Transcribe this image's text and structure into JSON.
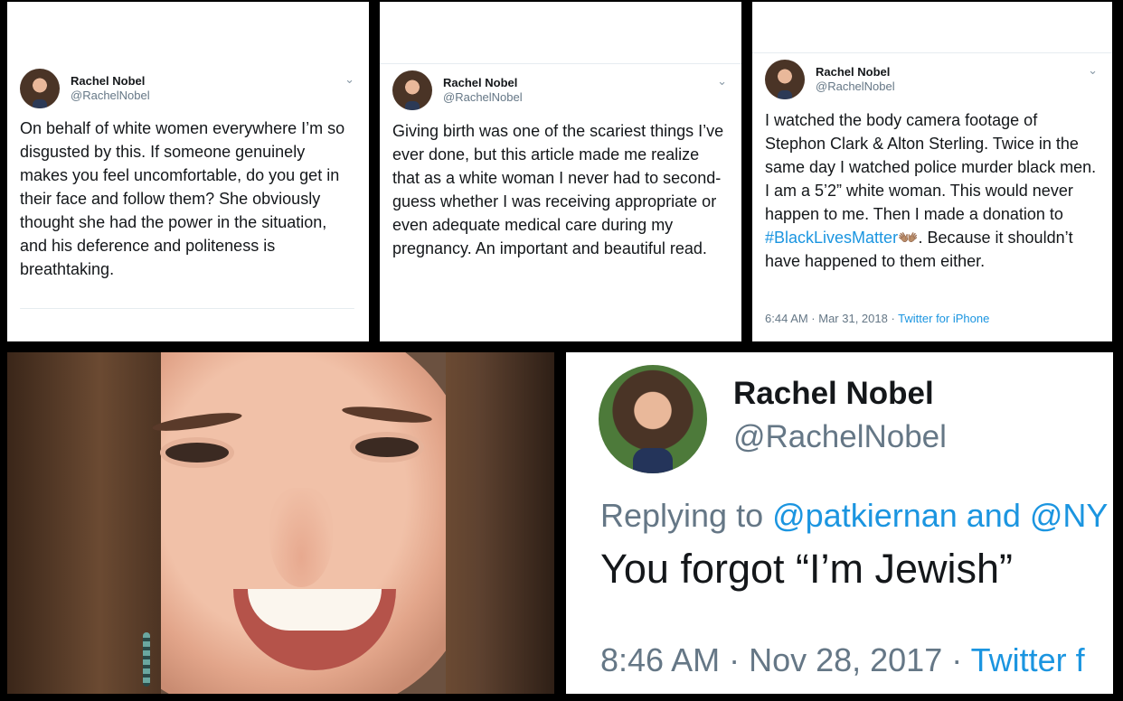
{
  "tweets": [
    {
      "name": "Rachel Nobel",
      "handle": "@RachelNobel",
      "text": "On behalf of white women everywhere I’m so disgusted by this. If someone genuinely makes you feel uncomfortable, do you get in their face and follow them? She obviously thought she had the power in the situation, and his deference and politeness is breathtaking."
    },
    {
      "name": "Rachel Nobel",
      "handle": "@RachelNobel",
      "text": "Giving birth was one of the scariest things I’ve ever done, but this article made me realize that as a white woman I never had to second-guess whether I was receiving appropriate or even adequate medical care during my pregnancy. An important and beautiful read."
    },
    {
      "name": "Rachel Nobel",
      "handle": "@RachelNobel",
      "text_before": "I watched the body camera footage of Stephon Clark & Alton Sterling. Twice in the same day I watched police murder black men. I am a 5’2” white woman. This would never happen to me. Then I made a donation to ",
      "hashtag": "#BlackLivesMatter",
      "emoji": "👐🏽",
      "text_after": ". Because it shouldn’t have happened to them either.",
      "time": "6:44 AM · Mar 31, 2018 · ",
      "source": "Twitter for iPhone"
    }
  ],
  "big_tweet": {
    "name": "Rachel Nobel",
    "handle": "@RachelNobel",
    "replying_prefix": "Replying to ",
    "replying_users": "@patkiernan and @NY",
    "text": "You forgot “I’m Jewish”",
    "time": "8:46 AM · Nov 28, 2017 · ",
    "source": "Twitter f"
  },
  "icons": {
    "chevron": "chevron-down-icon"
  },
  "colors": {
    "link": "#1b95e0",
    "text": "#14171a",
    "muted": "#657786"
  }
}
